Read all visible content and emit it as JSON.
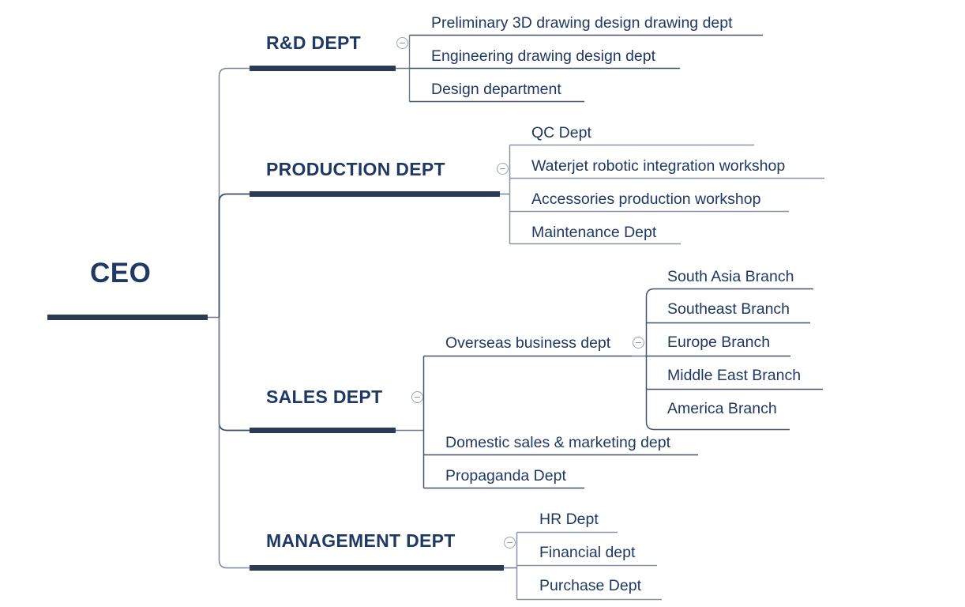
{
  "diagram": {
    "type": "org-chart-mindmap",
    "title": "CEO",
    "colors": {
      "text": "#1f3864",
      "accent_bar": "#2c3a54",
      "branch_bar": "#44546a",
      "connector": "#6b7890",
      "toggle_border": "#9aa3b2",
      "background": "#ffffff"
    },
    "root": {
      "label": "CEO",
      "level": 0,
      "collapsed": false
    },
    "branches": [
      {
        "label": "R&D DEPT",
        "level": 1,
        "toggle": "collapse-minus",
        "children": [
          {
            "label": "Preliminary 3D drawing design drawing dept",
            "level": 2
          },
          {
            "label": "Engineering drawing design dept",
            "level": 2
          },
          {
            "label": "Design department",
            "level": 2
          }
        ]
      },
      {
        "label": "PRODUCTION DEPT",
        "level": 1,
        "toggle": "collapse-minus",
        "children": [
          {
            "label": "QC Dept",
            "level": 2
          },
          {
            "label": "Waterjet robotic integration workshop",
            "level": 2
          },
          {
            "label": "Accessories production workshop",
            "level": 2
          },
          {
            "label": "Maintenance Dept",
            "level": 2
          }
        ]
      },
      {
        "label": "SALES DEPT",
        "level": 1,
        "toggle": "collapse-minus",
        "children": [
          {
            "label": "Overseas business dept",
            "level": 2,
            "toggle": "collapse-minus",
            "children": [
              {
                "label": "South Asia Branch",
                "level": 3
              },
              {
                "label": "Southeast Branch",
                "level": 3
              },
              {
                "label": "Europe Branch",
                "level": 3
              },
              {
                "label": "Middle East Branch",
                "level": 3
              },
              {
                "label": "America Branch",
                "level": 3
              }
            ]
          },
          {
            "label": "Domestic sales & marketing dept",
            "level": 2
          },
          {
            "label": "Propaganda Dept",
            "level": 2
          }
        ]
      },
      {
        "label": "MANAGEMENT DEPT",
        "level": 1,
        "toggle": "collapse-minus",
        "children": [
          {
            "label": "HR Dept",
            "level": 3
          },
          {
            "label": "Financial dept",
            "level": 3
          },
          {
            "label": "Purchase Dept",
            "level": 3
          }
        ]
      }
    ]
  }
}
